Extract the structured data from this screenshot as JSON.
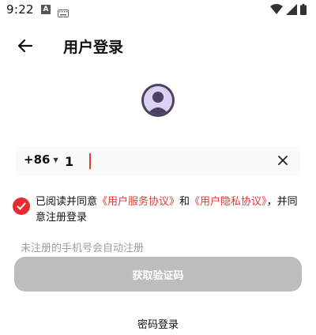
{
  "status_bar": {
    "time": "9:22",
    "notification_letter": "A"
  },
  "header": {
    "title": "用户登录"
  },
  "phone": {
    "country_code": "+86",
    "value": "1"
  },
  "agreement": {
    "prefix": "已阅读并同意",
    "service_link": "《用户服务协议》",
    "conj": "和",
    "privacy_link": "《用户隐私协议》",
    "suffix": "，并同意注册登录"
  },
  "hint": "未注册的手机号会自动注册",
  "buttons": {
    "get_code": "获取验证码",
    "password_login": "密码登录"
  },
  "colors": {
    "accent": "#e53935",
    "button_disabled": "#bdbdbd",
    "avatar_bg": "#4a4163"
  }
}
